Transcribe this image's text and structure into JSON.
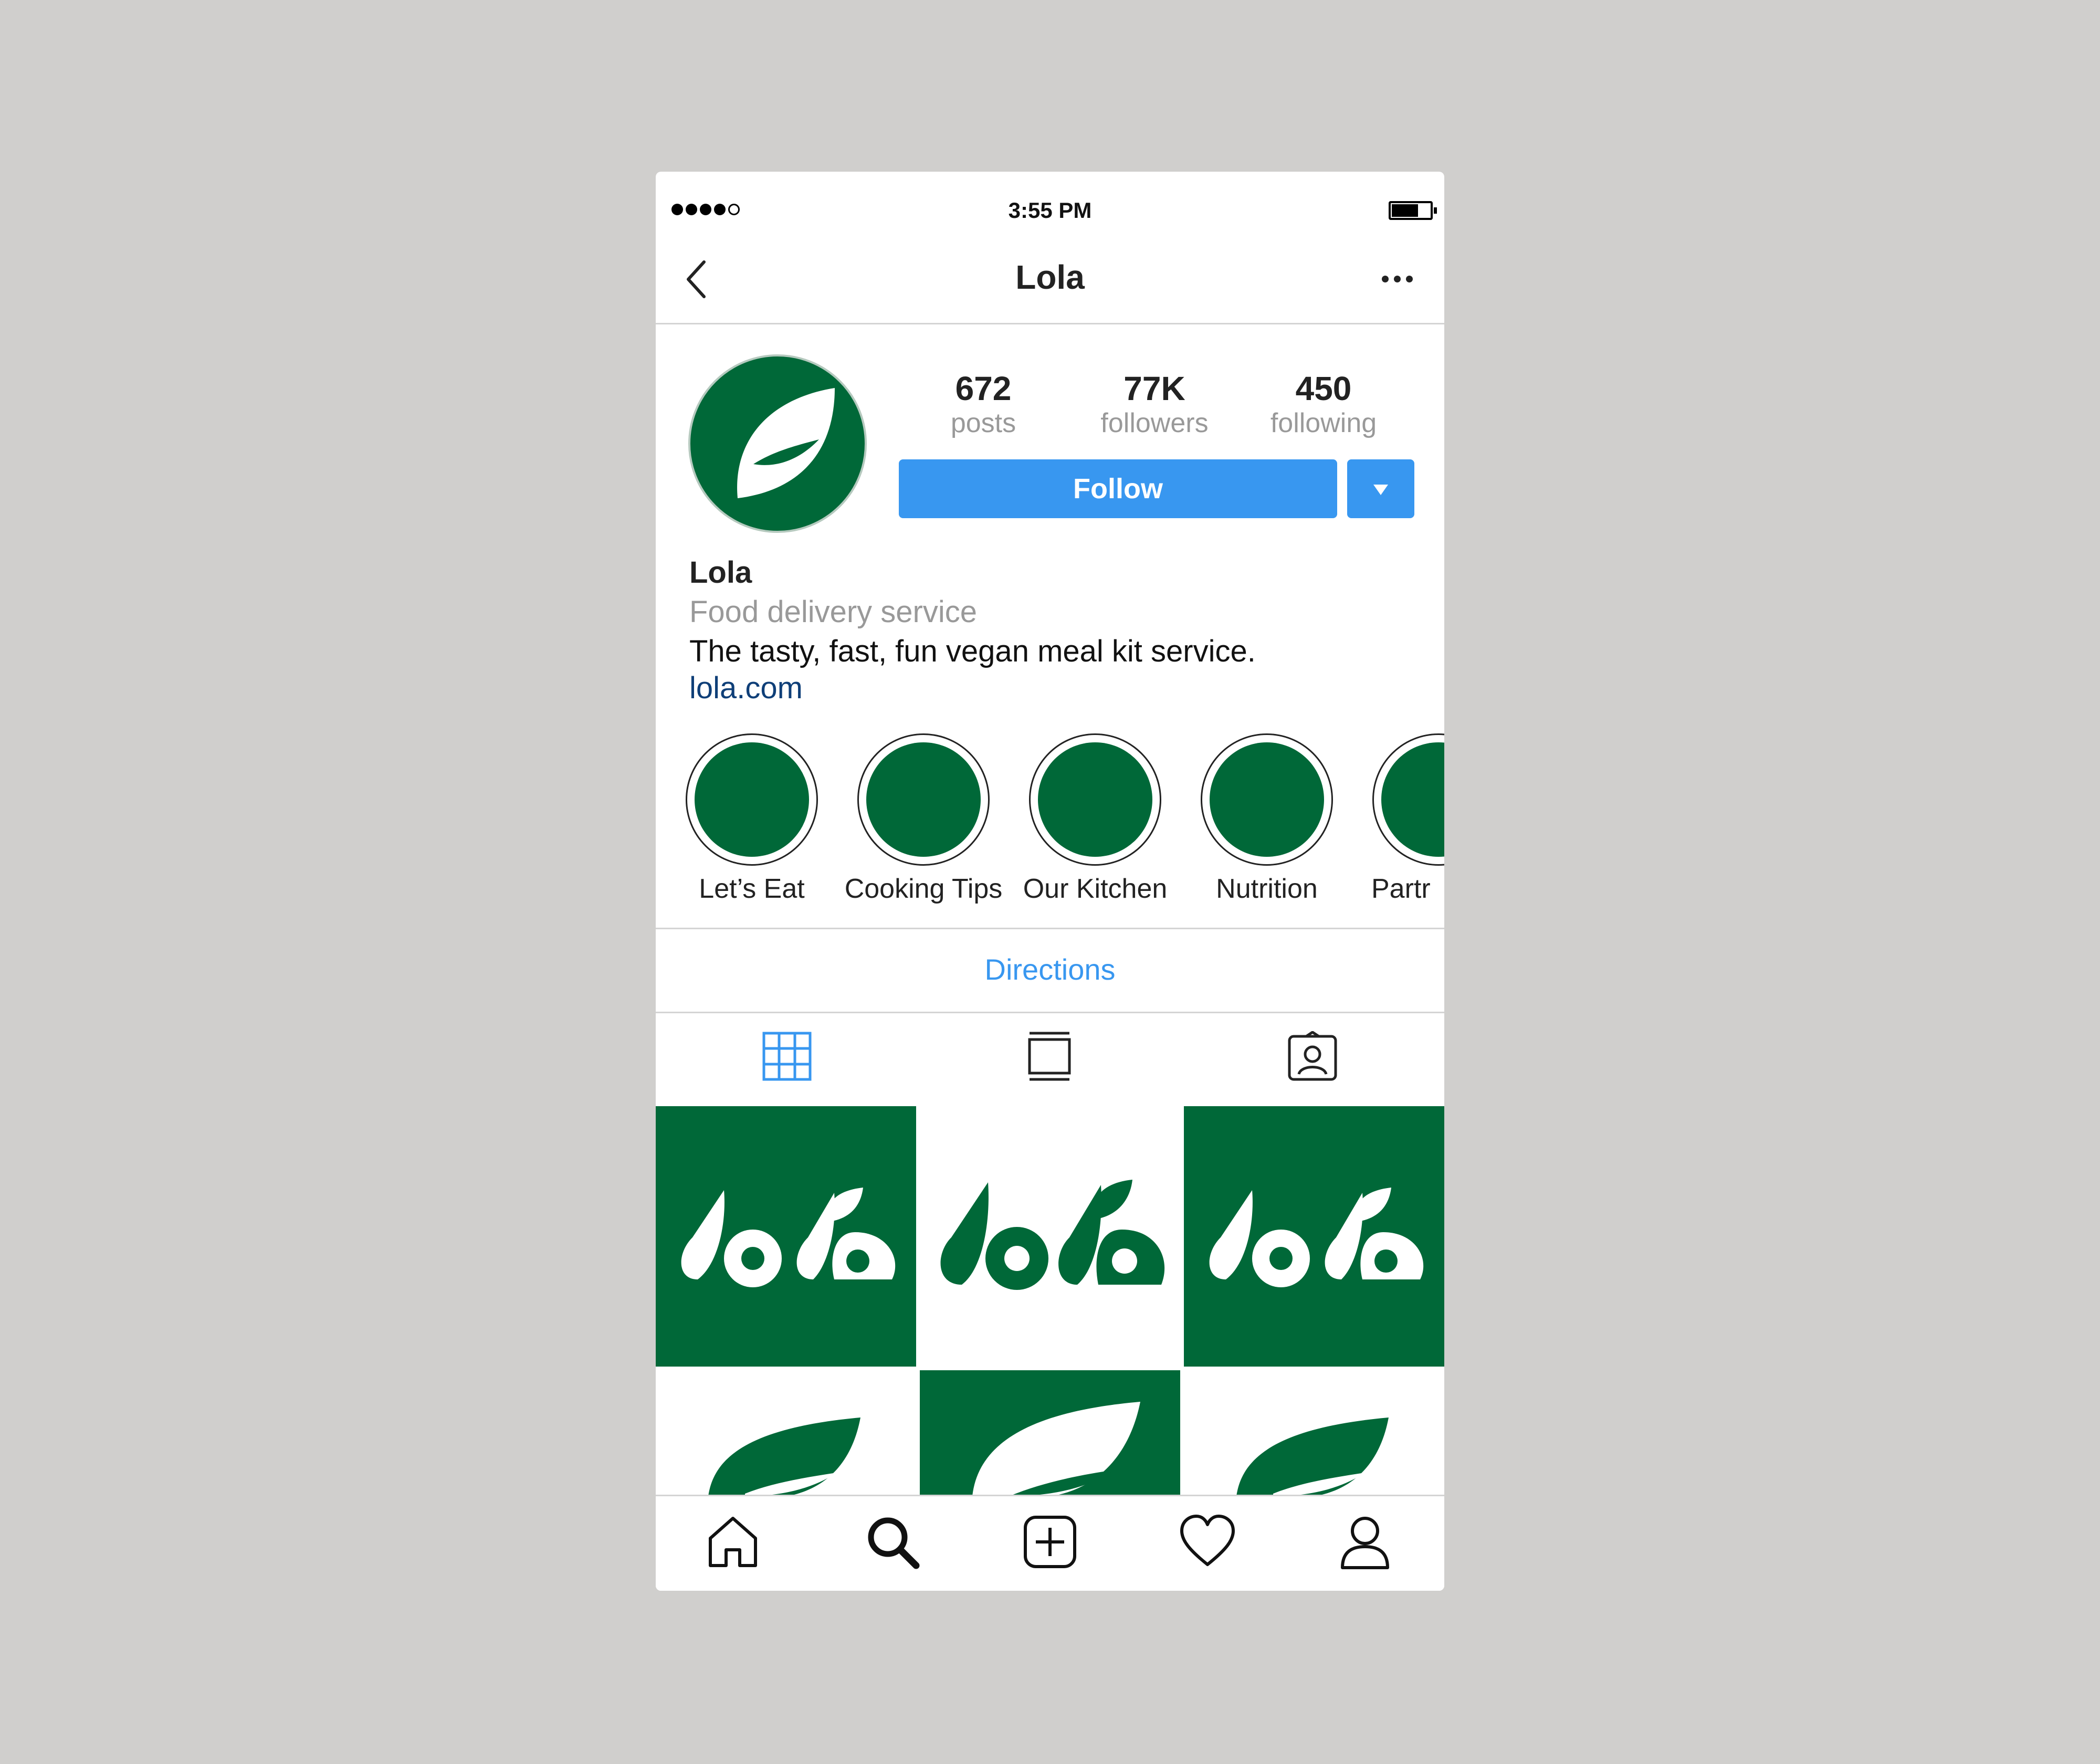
{
  "status_bar": {
    "time": "3:55 PM",
    "signal_bars_filled": 4,
    "signal_bars_total": 5,
    "battery_level": 0.7
  },
  "nav": {
    "title": "Lola",
    "back_icon": "chevron-left-icon",
    "more_icon": "more-horizontal-icon"
  },
  "profile": {
    "stats": [
      {
        "value": "672",
        "label": "posts"
      },
      {
        "value": "77K",
        "label": "followers"
      },
      {
        "value": "450",
        "label": "following"
      }
    ],
    "follow_label": "Follow",
    "name": "Lola",
    "category": "Food delivery service",
    "bio": "The tasty, fast, fun vegan meal kit service.",
    "link": "lola.com"
  },
  "highlights": [
    {
      "label": "Let’s Eat"
    },
    {
      "label": "Cooking Tips"
    },
    {
      "label": "Our Kitchen"
    },
    {
      "label": "Nutrition"
    },
    {
      "label": "Partr"
    }
  ],
  "directions_label": "Directions",
  "tabs": [
    {
      "icon": "grid-icon",
      "active": true
    },
    {
      "icon": "feed-icon",
      "active": false
    },
    {
      "icon": "tagged-icon",
      "active": false
    }
  ],
  "colors": {
    "brand_green": "#006838",
    "accent_blue": "#3897f0",
    "link_navy": "#0f3f78",
    "background": "#d0cfcd"
  },
  "bottom_nav": [
    {
      "icon": "home-icon"
    },
    {
      "icon": "search-icon"
    },
    {
      "icon": "add-post-icon"
    },
    {
      "icon": "heart-icon"
    },
    {
      "icon": "profile-icon"
    }
  ]
}
